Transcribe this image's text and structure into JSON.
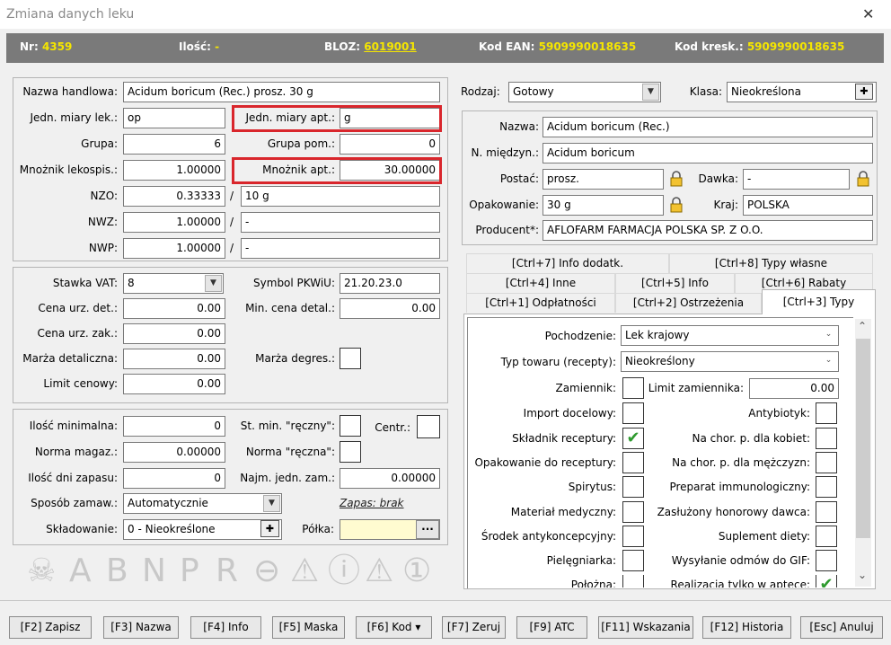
{
  "window": {
    "title": "Zmiana danych leku",
    "close": "✕"
  },
  "header": {
    "nr_label": "Nr:",
    "nr_value": "4359",
    "ilosc_label": "Ilość:",
    "ilosc_value": "-",
    "bloz_label": "BLOZ:",
    "bloz_value": "6019001",
    "ean_label": "Kod EAN:",
    "ean_value": "5909990018635",
    "kresk_label": "Kod kresk.:",
    "kresk_value": "5909990018635"
  },
  "left": {
    "nazwa_handlowa_label": "Nazwa handlowa:",
    "nazwa_handlowa": "Acidum boricum (Rec.) prosz. 30 g",
    "jedn_lek_label": "Jedn. miary lek.:",
    "jedn_lek": "op",
    "jedn_apt_label": "Jedn. miary apt.:",
    "jedn_apt": "g",
    "grupa_label": "Grupa:",
    "grupa": "6",
    "grupa_pom_label": "Grupa pom.:",
    "grupa_pom": "0",
    "mnoznik_lek_label": "Mnożnik lekospis.:",
    "mnoznik_lek": "1.00000",
    "mnoznik_apt_label": "Mnożnik apt.:",
    "mnoznik_apt": "30.00000",
    "nzo_label": "NZO:",
    "nzo": "0.33333",
    "nzo_jedn": "10 g",
    "nwz_label": "NWZ:",
    "nwz": "1.00000",
    "nwz_jedn": "-",
    "nwp_label": "NWP:",
    "nwp": "1.00000",
    "nwp_jedn": "-",
    "slash": "/"
  },
  "prices": {
    "vat_label": "Stawka VAT:",
    "vat": "8",
    "pkwiu_label": "Symbol PKWiU:",
    "pkwiu": "21.20.23.0",
    "cena_det_label": "Cena urz. det.:",
    "cena_det": "0.00",
    "min_cena_label": "Min. cena detal.:",
    "min_cena": "0.00",
    "cena_zak_label": "Cena urz. zak.:",
    "cena_zak": "0.00",
    "marza_det_label": "Marża detaliczna:",
    "marza_det": "0.00",
    "marza_deg_label": "Marża degres.:",
    "limit_label": "Limit cenowy:",
    "limit": "0.00"
  },
  "stock": {
    "ilosc_min_label": "Ilość minimalna:",
    "ilosc_min": "0",
    "st_min_label": "St. min. \"ręczny\":",
    "centr_label": "Centr.:",
    "norma_label": "Norma magaz.:",
    "norma": "0.00000",
    "norma_r_label": "Norma \"ręczna\":",
    "dni_label": "Ilość dni zapasu:",
    "dni": "0",
    "najm_label": "Najm. jedn. zam.:",
    "najm": "0.00000",
    "sposob_label": "Sposób zamaw.:",
    "sposob": "Automatycznie",
    "zapas": "Zapas: brak",
    "skladowanie_label": "Składowanie:",
    "skladowanie": "0 - Nieokreślone",
    "polka_label": "Półka:",
    "polka": "",
    "dots": "···",
    "plus": "✚"
  },
  "symbols": [
    "☠",
    "A",
    "B",
    "N",
    "P",
    "R",
    "⊖",
    "⚠",
    "ⓘ",
    "⚠",
    "①"
  ],
  "right": {
    "rodzaj_label": "Rodzaj:",
    "rodzaj": "Gotowy",
    "klasa_label": "Klasa:",
    "klasa": "Nieokreślona",
    "nazwa_label": "Nazwa:",
    "nazwa": "Acidum boricum (Rec.)",
    "miedzyn_label": "N. międzyn.:",
    "miedzyn": "Acidum boricum",
    "postac_label": "Postać:",
    "postac": "prosz.",
    "dawka_label": "Dawka:",
    "dawka": "-",
    "opak_label": "Opakowanie:",
    "opak": "30 g",
    "kraj_label": "Kraj:",
    "kraj": "POLSKA",
    "producent_label": "Producent*:",
    "producent": "AFLOFARM FARMACJA POLSKA SP. Z O.O."
  },
  "tabs": {
    "row1": [
      "[Ctrl+7] Info dodatk.",
      "[Ctrl+8] Typy własne"
    ],
    "row2": [
      "[Ctrl+4] Inne",
      "[Ctrl+5] Info",
      "[Ctrl+6] Rabaty"
    ],
    "row3": [
      "[Ctrl+1] Odpłatności",
      "[Ctrl+2] Ostrzeżenia",
      "[Ctrl+3] Typy"
    ]
  },
  "typy": {
    "pochodzenie_label": "Pochodzenie:",
    "pochodzenie": "Lek krajowy",
    "typ_label": "Typ towaru (recepty):",
    "typ": "Nieokreślony",
    "zamiennik_label": "Zamiennik:",
    "limit_zam_label": "Limit zamiennika:",
    "limit_zam": "0.00",
    "import_label": "Import docelowy:",
    "antybiotyk_label": "Antybiotyk:",
    "skladnik_label": "Składnik receptury:",
    "kobiet_label": "Na chor. p. dla kobiet:",
    "opak_rec_label": "Opakowanie do receptury:",
    "mezczyzn_label": "Na chor. p. dla mężczyzn:",
    "spirytus_label": "Spirytus:",
    "immuno_label": "Preparat immunologiczny:",
    "material_label": "Materiał medyczny:",
    "dawca_label": "Zasłużony honorowy dawca:",
    "antykonc_label": "Środek antykoncepcyjny:",
    "suplement_label": "Suplement diety:",
    "pielegniarka_label": "Pielęgniarka:",
    "gif_label": "Wysyłanie odmów do GIF:",
    "polozna_label": "Położna:",
    "apteka_label": "Realizacja tylko w aptece:",
    "check": "✔"
  },
  "footer": [
    "[F2] Zapisz",
    "[F3] Nazwa",
    "[F4] Info",
    "[F5] Maska",
    "[F6] Kod ▾",
    "[F7] Zeruj",
    "[F9] ATC",
    "[F11] Wskazania",
    "[F12] Historia",
    "[Esc] Anuluj"
  ],
  "colors": {
    "header_bg": "#7a7a7a",
    "header_value": "#f5e600",
    "highlight": "#d9262c",
    "check": "#2e9a2e"
  }
}
